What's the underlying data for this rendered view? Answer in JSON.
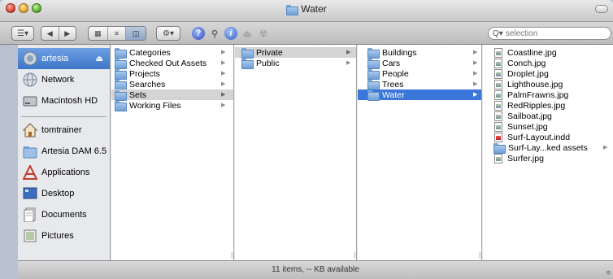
{
  "window": {
    "title": "Water"
  },
  "toolbar": {
    "search_placeholder": "selection",
    "icons": [
      "sidebar-toggle-icon",
      "back-icon",
      "forward-icon",
      "icon-view-icon",
      "list-view-icon",
      "column-view-icon",
      "action-gear-icon",
      "help-icon",
      "search-icon",
      "info-icon",
      "eject-icon",
      "burn-icon"
    ]
  },
  "sidebar": {
    "items": [
      {
        "label": "artesia",
        "icon": "network-disk-icon",
        "selected": true
      },
      {
        "label": "Network",
        "icon": "network-globe-icon"
      },
      {
        "label": "Macintosh HD",
        "icon": "hard-drive-icon"
      },
      {
        "label": "tomtrainer",
        "icon": "home-icon"
      },
      {
        "label": "Artesia DAM 6.5",
        "icon": "folder-icon"
      },
      {
        "label": "Applications",
        "icon": "applications-icon"
      },
      {
        "label": "Desktop",
        "icon": "desktop-icon"
      },
      {
        "label": "Documents",
        "icon": "documents-icon"
      },
      {
        "label": "Pictures",
        "icon": "pictures-icon"
      }
    ]
  },
  "columns": [
    {
      "items": [
        {
          "label": "Categories",
          "kind": "folder",
          "arrow": true
        },
        {
          "label": "Checked Out Assets",
          "kind": "folder",
          "arrow": true
        },
        {
          "label": "Projects",
          "kind": "folder",
          "arrow": true
        },
        {
          "label": "Searches",
          "kind": "folder",
          "arrow": true
        },
        {
          "label": "Sets",
          "kind": "folder",
          "arrow": true,
          "state": "highlight"
        },
        {
          "label": "Working Files",
          "kind": "folder",
          "arrow": true
        }
      ]
    },
    {
      "items": [
        {
          "label": "Private",
          "kind": "folder",
          "arrow": true,
          "state": "highlight"
        },
        {
          "label": "Public",
          "kind": "folder",
          "arrow": true
        }
      ]
    },
    {
      "items": [
        {
          "label": "Buildings",
          "kind": "folder",
          "arrow": true
        },
        {
          "label": "Cars",
          "kind": "folder",
          "arrow": true
        },
        {
          "label": "People",
          "kind": "folder",
          "arrow": true
        },
        {
          "label": "Trees",
          "kind": "folder",
          "arrow": true
        },
        {
          "label": "Water",
          "kind": "folder",
          "arrow": true,
          "state": "selected"
        }
      ]
    },
    {
      "items": [
        {
          "label": "Coastline.jpg",
          "kind": "file"
        },
        {
          "label": "Conch.jpg",
          "kind": "file"
        },
        {
          "label": "Droplet.jpg",
          "kind": "file"
        },
        {
          "label": "Lighthouse.jpg",
          "kind": "file"
        },
        {
          "label": "PalmFrawns.jpg",
          "kind": "file"
        },
        {
          "label": "RedRipples.jpg",
          "kind": "file"
        },
        {
          "label": "Sailboat.jpg",
          "kind": "file"
        },
        {
          "label": "Sunset.jpg",
          "kind": "file"
        },
        {
          "label": "Surf-Layout.indd",
          "kind": "indd"
        },
        {
          "label": "Surf-Lay...ked assets",
          "kind": "folder",
          "arrow": true
        },
        {
          "label": "Surfer.jpg",
          "kind": "file"
        }
      ]
    }
  ],
  "status": {
    "text": "11 items, -- KB available"
  },
  "colors": {
    "selection": "#3b76d9",
    "sidebar_selection": "#4a82d3",
    "highlight": "#d4d4d4"
  }
}
